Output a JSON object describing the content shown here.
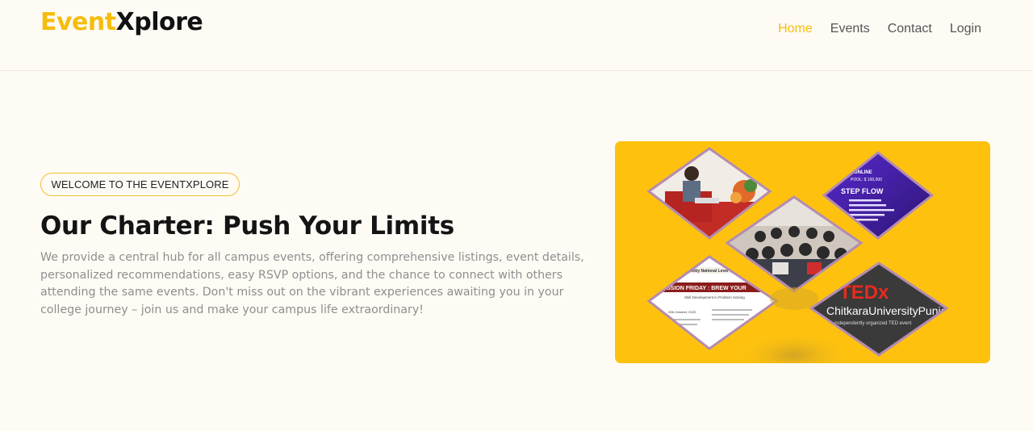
{
  "header": {
    "logo": {
      "part1": "Event",
      "part2": "Xplore"
    },
    "nav": [
      {
        "label": "Home",
        "active": true
      },
      {
        "label": "Events",
        "active": false
      },
      {
        "label": "Contact",
        "active": false
      },
      {
        "label": "Login",
        "active": false
      }
    ]
  },
  "hero": {
    "badge": "WELCOME TO THE EVENTXPLORE",
    "title": "Our Charter: Push Your Limits",
    "description": "We provide a central hub for all campus events, offering comprehensive listings, event details, personalized recommendations, easy RSVP options, and the chance to connect with others attending the same events. Don't miss out on the vibrant experiences awaiting you in your college journey – join us and make your campus life extraordinary!"
  },
  "collage": {
    "step_flow_title": "STEP FLOW",
    "step_flow_online": "ONLINE",
    "step_flow_pool": "POOL: $ 100,000",
    "poster_title": "SSION FRIDAY : BREW YOUR",
    "poster_subtitle": "Skill Development in Problem Solving",
    "poster_header": "Weekly National Level C",
    "poster_date": "20th October, 2023",
    "tedx_logo": "TEDx",
    "tedx_name": "ChitkaraUniversityPunjab",
    "tedx_tagline": "independently organized TED event"
  },
  "colors": {
    "accent": "#f5bd0c",
    "hero_bg": "#fec20e",
    "page_bg": "#fefbf5",
    "tedx_red": "#e62b1e"
  }
}
